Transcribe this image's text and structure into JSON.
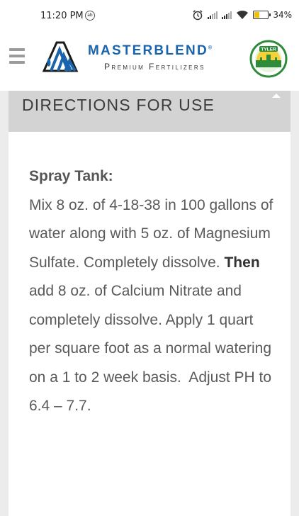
{
  "status_bar": {
    "time": "11:20 PM",
    "battery_percent": "34%",
    "battery_level": 0.34,
    "icons": [
      "alarm-icon",
      "signal-icon",
      "signal-icon",
      "wifi-icon",
      "battery-icon"
    ]
  },
  "header": {
    "menu_icon": "hamburger-menu-icon",
    "brand_name": "MASTERBLEND",
    "brand_tagline": "Premium Fertilizers",
    "partner_badge_text": "TYLER",
    "brand_color": "#1a63ad"
  },
  "section": {
    "title": "DIRECTIONS FOR USE",
    "collapse_icon": "chevron-up-icon",
    "subheading": "Spray Tank:",
    "text_part1": "Mix 8 oz. of 4-18-38 in 100 gallons of water along with 5 oz. of Magnesium Sulfate. Completely dissolve.",
    "text_bold": "Then",
    "text_part2": "add 8 oz. of Calcium Nitrate and completely dissolve. Apply 1 quart per square foot as a normal watering on a 1 to 2 week basis.  Adjust PH to 6.4 – 7.7."
  }
}
